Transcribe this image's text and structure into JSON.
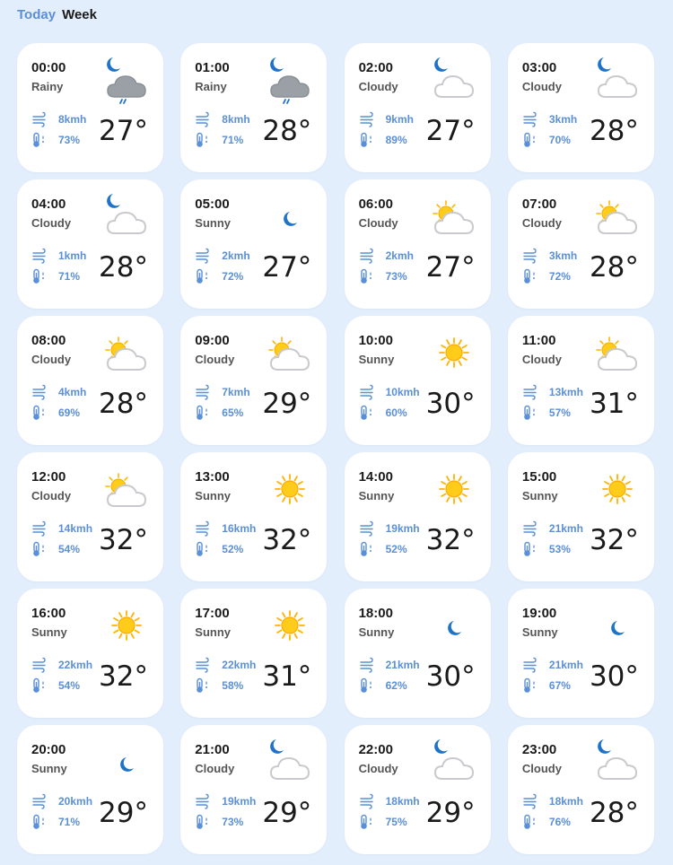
{
  "tabs": {
    "today": "Today",
    "week": "Week"
  },
  "colors": {
    "accent": "#5b8fd6",
    "background": "#e3eefc",
    "card": "#ffffff",
    "moon": "#1e73c8",
    "sun": "#ffcc1a"
  },
  "hours": [
    {
      "time": "00:00",
      "condition": "Rainy",
      "icon": "moon-rain-cloud-icon",
      "wind": "8kmh",
      "humidity": "73%",
      "temp": "27°"
    },
    {
      "time": "01:00",
      "condition": "Rainy",
      "icon": "moon-rain-cloud-icon",
      "wind": "8kmh",
      "humidity": "71%",
      "temp": "28°"
    },
    {
      "time": "02:00",
      "condition": "Cloudy",
      "icon": "moon-cloud-icon",
      "wind": "9kmh",
      "humidity": "89%",
      "temp": "27°"
    },
    {
      "time": "03:00",
      "condition": "Cloudy",
      "icon": "moon-cloud-icon",
      "wind": "3kmh",
      "humidity": "70%",
      "temp": "28°"
    },
    {
      "time": "04:00",
      "condition": "Cloudy",
      "icon": "moon-cloud-icon",
      "wind": "1kmh",
      "humidity": "71%",
      "temp": "28°"
    },
    {
      "time": "05:00",
      "condition": "Sunny",
      "icon": "moon-icon",
      "wind": "2kmh",
      "humidity": "72%",
      "temp": "27°"
    },
    {
      "time": "06:00",
      "condition": "Cloudy",
      "icon": "sun-cloud-icon",
      "wind": "2kmh",
      "humidity": "73%",
      "temp": "27°"
    },
    {
      "time": "07:00",
      "condition": "Cloudy",
      "icon": "sun-cloud-icon",
      "wind": "3kmh",
      "humidity": "72%",
      "temp": "28°"
    },
    {
      "time": "08:00",
      "condition": "Cloudy",
      "icon": "sun-cloud-icon",
      "wind": "4kmh",
      "humidity": "69%",
      "temp": "28°"
    },
    {
      "time": "09:00",
      "condition": "Cloudy",
      "icon": "sun-cloud-icon",
      "wind": "7kmh",
      "humidity": "65%",
      "temp": "29°"
    },
    {
      "time": "10:00",
      "condition": "Sunny",
      "icon": "sun-icon",
      "wind": "10kmh",
      "humidity": "60%",
      "temp": "30°"
    },
    {
      "time": "11:00",
      "condition": "Cloudy",
      "icon": "sun-cloud-icon",
      "wind": "13kmh",
      "humidity": "57%",
      "temp": "31°"
    },
    {
      "time": "12:00",
      "condition": "Cloudy",
      "icon": "sun-cloud-icon",
      "wind": "14kmh",
      "humidity": "54%",
      "temp": "32°"
    },
    {
      "time": "13:00",
      "condition": "Sunny",
      "icon": "sun-icon",
      "wind": "16kmh",
      "humidity": "52%",
      "temp": "32°"
    },
    {
      "time": "14:00",
      "condition": "Sunny",
      "icon": "sun-icon",
      "wind": "19kmh",
      "humidity": "52%",
      "temp": "32°"
    },
    {
      "time": "15:00",
      "condition": "Sunny",
      "icon": "sun-icon",
      "wind": "21kmh",
      "humidity": "53%",
      "temp": "32°"
    },
    {
      "time": "16:00",
      "condition": "Sunny",
      "icon": "sun-icon",
      "wind": "22kmh",
      "humidity": "54%",
      "temp": "32°"
    },
    {
      "time": "17:00",
      "condition": "Sunny",
      "icon": "sun-icon",
      "wind": "22kmh",
      "humidity": "58%",
      "temp": "31°"
    },
    {
      "time": "18:00",
      "condition": "Sunny",
      "icon": "moon-icon",
      "wind": "21kmh",
      "humidity": "62%",
      "temp": "30°"
    },
    {
      "time": "19:00",
      "condition": "Sunny",
      "icon": "moon-icon",
      "wind": "21kmh",
      "humidity": "67%",
      "temp": "30°"
    },
    {
      "time": "20:00",
      "condition": "Sunny",
      "icon": "moon-icon",
      "wind": "20kmh",
      "humidity": "71%",
      "temp": "29°"
    },
    {
      "time": "21:00",
      "condition": "Cloudy",
      "icon": "moon-cloud-icon",
      "wind": "19kmh",
      "humidity": "73%",
      "temp": "29°"
    },
    {
      "time": "22:00",
      "condition": "Cloudy",
      "icon": "moon-cloud-icon",
      "wind": "18kmh",
      "humidity": "75%",
      "temp": "29°"
    },
    {
      "time": "23:00",
      "condition": "Cloudy",
      "icon": "moon-cloud-icon",
      "wind": "18kmh",
      "humidity": "76%",
      "temp": "28°"
    }
  ]
}
